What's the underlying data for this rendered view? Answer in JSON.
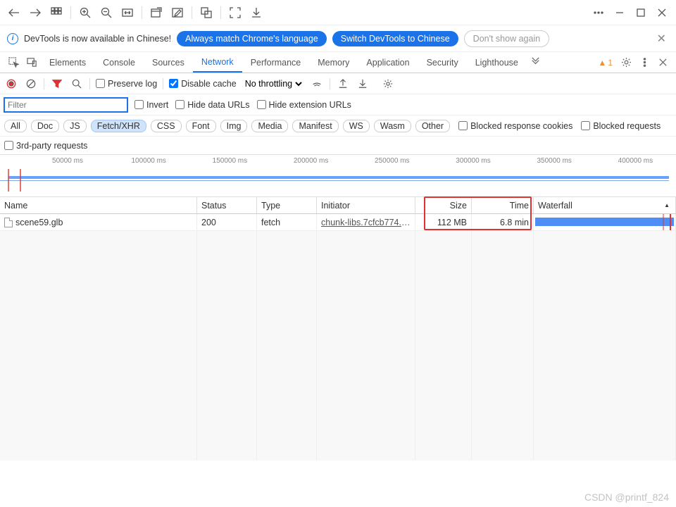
{
  "infobar": {
    "text": "DevTools is now available in Chinese!",
    "btn1": "Always match Chrome's language",
    "btn2": "Switch DevTools to Chinese",
    "btn3": "Don't show again"
  },
  "tabs": {
    "elements": "Elements",
    "console": "Console",
    "sources": "Sources",
    "network": "Network",
    "performance": "Performance",
    "memory": "Memory",
    "application": "Application",
    "security": "Security",
    "lighthouse": "Lighthouse",
    "warn_count": "1"
  },
  "net_toolbar": {
    "preserve": "Preserve log",
    "disable_cache": "Disable cache",
    "throttling": "No throttling"
  },
  "filters": {
    "placeholder": "Filter",
    "invert": "Invert",
    "hide_data": "Hide data URLs",
    "hide_ext": "Hide extension URLs"
  },
  "chips": {
    "all": "All",
    "doc": "Doc",
    "js": "JS",
    "fetch": "Fetch/XHR",
    "css": "CSS",
    "font": "Font",
    "img": "Img",
    "media": "Media",
    "manifest": "Manifest",
    "ws": "WS",
    "wasm": "Wasm",
    "other": "Other",
    "blocked_cookies": "Blocked response cookies",
    "blocked_req": "Blocked requests",
    "third_party": "3rd-party requests"
  },
  "timeline": {
    "ticks": [
      "50000 ms",
      "100000 ms",
      "150000 ms",
      "200000 ms",
      "250000 ms",
      "300000 ms",
      "350000 ms",
      "400000 ms"
    ]
  },
  "headers": {
    "name": "Name",
    "status": "Status",
    "type": "Type",
    "initiator": "Initiator",
    "size": "Size",
    "time": "Time",
    "waterfall": "Waterfall"
  },
  "rows": [
    {
      "name": "scene59.glb",
      "status": "200",
      "type": "fetch",
      "initiator": "chunk-libs.7cfcb774.j…",
      "size": "112 MB",
      "time": "6.8 min"
    }
  ],
  "watermark": "CSDN @printf_824"
}
